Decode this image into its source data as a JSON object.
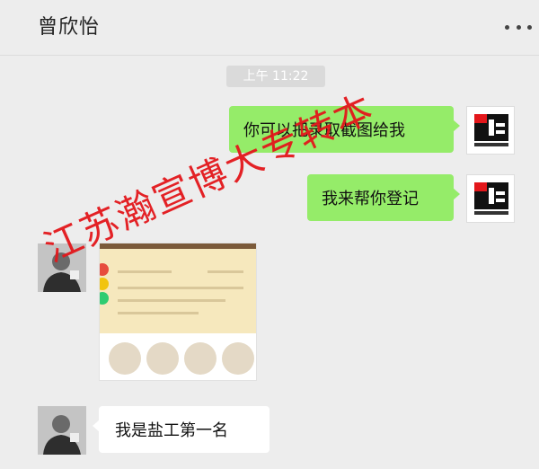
{
  "header": {
    "contact_name": "曾欣怡",
    "more_icon": "more-icon"
  },
  "timestamp": "上午 11:22",
  "messages": [
    {
      "sender": "me",
      "type": "text",
      "text": "你可以把录取截图给我"
    },
    {
      "sender": "me",
      "type": "text",
      "text": "我来帮你登记"
    },
    {
      "sender": "them",
      "type": "image"
    },
    {
      "sender": "them",
      "type": "text",
      "text": "我是盐工第一名"
    }
  ],
  "watermark": "江苏瀚宣博大专转本",
  "colors": {
    "background": "#ededed",
    "my_bubble": "#95ec69",
    "their_bubble": "#ffffff",
    "watermark": "#e3171b"
  }
}
